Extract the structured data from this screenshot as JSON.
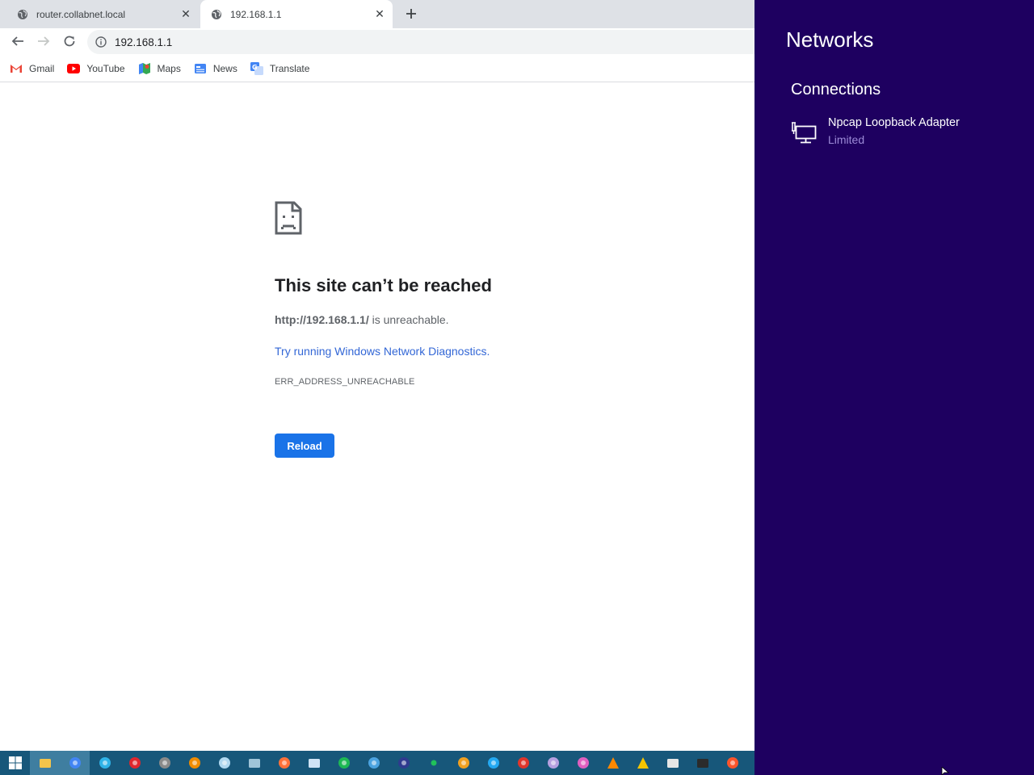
{
  "browser": {
    "tabs": [
      {
        "title": "router.collabnet.local",
        "favicon": "globe-icon",
        "active": false
      },
      {
        "title": "192.168.1.1",
        "favicon": "globe-icon",
        "active": true
      }
    ],
    "address": "192.168.1.1",
    "bookmarks": [
      {
        "label": "Gmail",
        "icon": "gmail-icon",
        "color": "#ea4335"
      },
      {
        "label": "YouTube",
        "icon": "youtube-icon",
        "color": "#ff0000"
      },
      {
        "label": "Maps",
        "icon": "maps-icon",
        "color": "#34a853"
      },
      {
        "label": "News",
        "icon": "news-icon",
        "color": "#4285f4"
      },
      {
        "label": "Translate",
        "icon": "translate-icon",
        "color": "#4285f4"
      }
    ]
  },
  "error": {
    "title": "This site can’t be reached",
    "url": "http://192.168.1.1/",
    "suffix": " is unreachable.",
    "link": "Try running Windows Network Diagnostics.",
    "code": "ERR_ADDRESS_UNREACHABLE",
    "button": "Reload"
  },
  "networks": {
    "title": "Networks",
    "section": "Connections",
    "items": [
      {
        "name": "Npcap Loopback Adapter",
        "status": "Limited",
        "icon": "wired-network-icon"
      }
    ]
  },
  "taskbar": {
    "items": [
      {
        "icon": "windows-start-icon",
        "color": "#ffffff"
      },
      {
        "icon": "file-explorer-icon",
        "color": "#f3c44b"
      },
      {
        "icon": "chrome-icon",
        "color": "#4285f4"
      },
      {
        "icon": "edge-icon",
        "color": "#2fb3e8"
      },
      {
        "icon": "opera-icon",
        "color": "#e0262d"
      },
      {
        "icon": "raccoon-app-icon",
        "color": "#8a8a8a"
      },
      {
        "icon": "search-tool-icon",
        "color": "#f08c00"
      },
      {
        "icon": "link-tool-icon",
        "color": "#b0d8f0"
      },
      {
        "icon": "photo-viewer-icon",
        "color": "#a0c4d8"
      },
      {
        "icon": "firefox-icon",
        "color": "#ff7139"
      },
      {
        "icon": "files-app-icon",
        "color": "#cfe3f5"
      },
      {
        "icon": "spotify-icon",
        "color": "#1db954"
      },
      {
        "icon": "wifi-tool-icon",
        "color": "#4ba3e0"
      },
      {
        "icon": "lock-app-icon",
        "color": "#2f3a8f"
      },
      {
        "icon": "green-dot-icon",
        "color": "#21c15a"
      },
      {
        "icon": "vpn-app-icon",
        "color": "#f0a020"
      },
      {
        "icon": "vscode-icon",
        "color": "#23a9f2"
      },
      {
        "icon": "screenshot-app-icon",
        "color": "#e0352b"
      },
      {
        "icon": "ghost-app-icon",
        "color": "#b6a0e0"
      },
      {
        "icon": "color-app-icon",
        "color": "#e060c0"
      },
      {
        "icon": "vlc-icon",
        "color": "#ff8800"
      },
      {
        "icon": "triangle-app-icon",
        "color": "#f5c400"
      },
      {
        "icon": "clapper-app-icon",
        "color": "#e6e6e6"
      },
      {
        "icon": "terminal-icon",
        "color": "#2b2b2b"
      },
      {
        "icon": "brave-icon",
        "color": "#fb542b"
      }
    ]
  }
}
